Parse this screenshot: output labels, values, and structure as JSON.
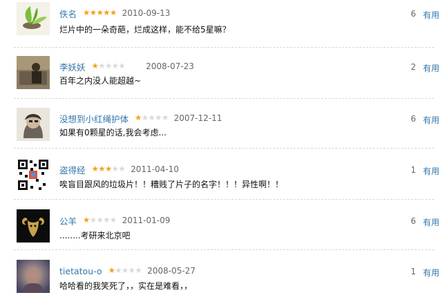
{
  "reviews": [
    {
      "author": "佚名",
      "rating": 5,
      "date": "2010-09-13",
      "text": "烂片中的一朵奇葩，烂成这样，能不给5星嘛？",
      "useful_count": "6",
      "useful_label": "有用",
      "avatar": "leaf-logo-avatar"
    },
    {
      "author": "李妖妖",
      "rating": 1,
      "date": "2008-07-23",
      "text": "百年之内没人能超越~",
      "useful_count": "2",
      "useful_label": "有用",
      "avatar": "sepia-room-avatar"
    },
    {
      "author": "没想到小红绳护体",
      "rating": 1,
      "date": "2007-12-11",
      "text": "如果有0颗星的话,我会考虑...",
      "useful_count": "6",
      "useful_label": "有用",
      "avatar": "sketch-portrait-avatar"
    },
    {
      "author": "盗得经",
      "rating": 3,
      "date": "2011-04-10",
      "text": "唉盲目跟风的垃圾片！！糟贱了片子的名字！！！异性啊！！",
      "useful_count": "1",
      "useful_label": "有用",
      "avatar": "qr-code-avatar"
    },
    {
      "author": "公羊",
      "rating": 1,
      "date": "2011-01-09",
      "text": "........考研来北京吧",
      "useful_count": "6",
      "useful_label": "有用",
      "avatar": "ram-emblem-avatar"
    },
    {
      "author": "tietatou-o",
      "rating": 1,
      "date": "2008-05-27",
      "text": "哈哈看的我笑死了，，实在是难看，，",
      "useful_count": "1",
      "useful_label": "有用",
      "avatar": "blurry-photo-avatar"
    }
  ],
  "colors": {
    "link": "#3377aa",
    "star_on": "#f4a21b",
    "star_off": "#d9d9d9",
    "meta": "#666666"
  }
}
